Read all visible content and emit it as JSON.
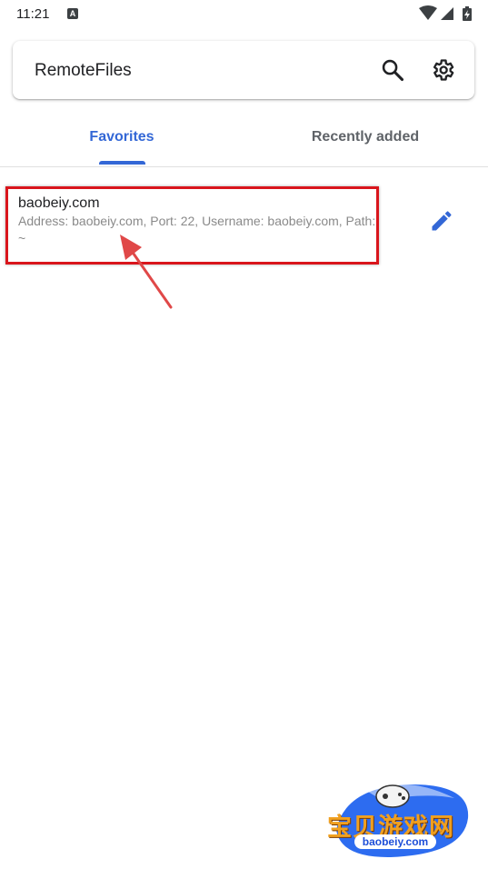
{
  "status_bar": {
    "time": "11:21",
    "notification_letter": "A"
  },
  "search_bar": {
    "title": "RemoteFiles"
  },
  "tabs": [
    {
      "label": "Favorites",
      "selected": true
    },
    {
      "label": "Recently added",
      "selected": false
    }
  ],
  "favorites": [
    {
      "title": "baobeiy.com",
      "subtitle": "Address: baobeiy.com, Port: 22, Username: baobeiy.com, Path: ~"
    }
  ],
  "watermark": {
    "text": "宝贝游戏网",
    "url": "baobeiy.com"
  },
  "colors": {
    "accent": "#3367d6",
    "highlight": "#d9151c",
    "arrow": "#e04848"
  }
}
